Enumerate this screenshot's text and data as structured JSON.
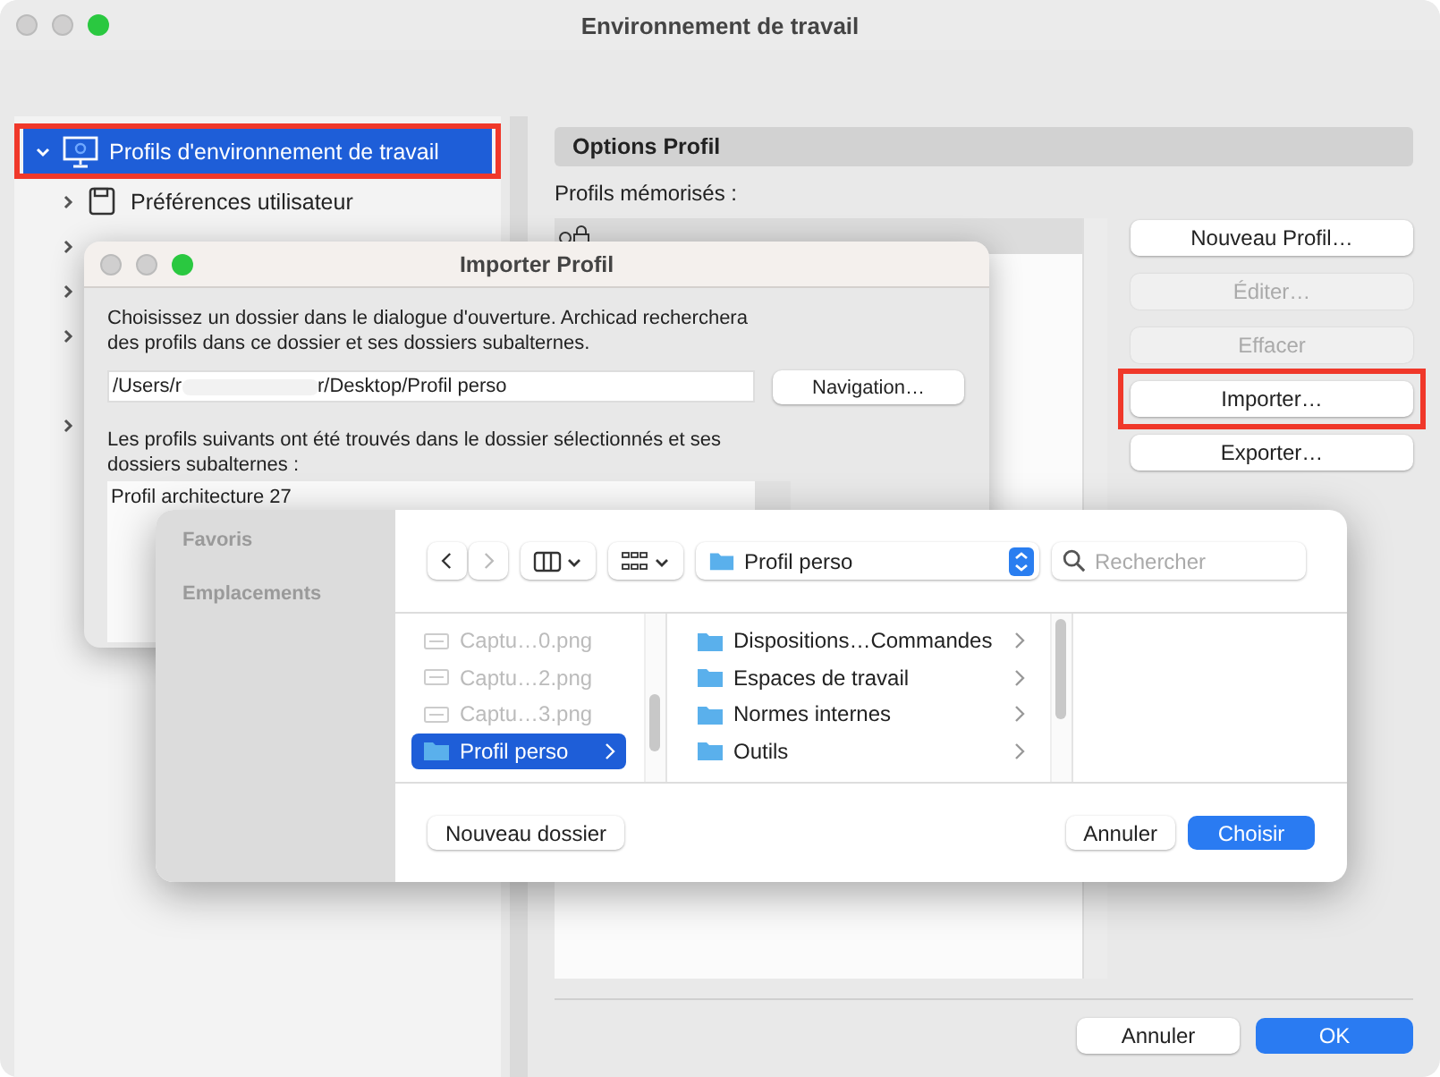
{
  "window": {
    "title": "Environnement de travail"
  },
  "tree": [
    {
      "label": "Profils d'environnement de travail",
      "selected": true,
      "expanded": true,
      "annotated": true,
      "children": [
        {
          "label": "Préférences utilisateur",
          "expandable": true
        },
        {
          "expandable": true
        },
        {
          "expandable": true
        },
        {
          "expandable": true
        },
        {
          "expandable": false
        },
        {
          "expandable": true
        }
      ]
    }
  ],
  "options": {
    "title": "Options Profil",
    "list_label": "Profils mémorisés :",
    "profiles": [
      {
        "selected": true
      }
    ],
    "buttons": [
      {
        "label": "Nouveau Profil…",
        "disabled": false,
        "annotated": false
      },
      {
        "label": "Éditer…",
        "disabled": true,
        "annotated": false
      },
      {
        "label": "Effacer",
        "disabled": true,
        "annotated": false
      },
      {
        "label": "Importer…",
        "disabled": false,
        "annotated": true
      },
      {
        "label": "Exporter…",
        "disabled": false,
        "annotated": false
      }
    ]
  },
  "footer_buttons": [
    {
      "label": "Annuler",
      "primary": false
    },
    {
      "label": "OK",
      "primary": true
    }
  ],
  "import_dialog": {
    "title": "Importer Profil",
    "instructions": "Choisissez un dossier dans le dialogue d'ouverture. Archicad recherchera des profils dans ce dossier et ses dossiers subalternes.",
    "path_start": "/Users/r",
    "path_end": "r/Desktop/Profil perso",
    "browse_button": "Navigation…",
    "found_label": "Les profils suivants ont été trouvés dans le dossier sélectionnés et ses dossiers subalternes :",
    "found": [
      "Profil architecture 27"
    ]
  },
  "finder": {
    "sidebar": [
      "Favoris",
      "Emplacements"
    ],
    "location": "Profil perso",
    "search_placeholder": "Rechercher",
    "column_1": [
      {
        "label": "Captu…0.png",
        "kind": "file",
        "disabled": true,
        "selected": false
      },
      {
        "label": "Captu…2.png",
        "kind": "file",
        "disabled": true,
        "selected": false
      },
      {
        "label": "Captu…3.png",
        "kind": "file",
        "disabled": true,
        "selected": false
      },
      {
        "label": "Profil perso",
        "kind": "folder",
        "disabled": false,
        "selected": true
      }
    ],
    "column_2": [
      {
        "label": "Dispositions…Commandes",
        "kind": "folder",
        "disabled": false,
        "selected": false
      },
      {
        "label": "Espaces de travail",
        "kind": "folder",
        "disabled": false,
        "selected": false
      },
      {
        "label": "Normes internes",
        "kind": "folder",
        "disabled": false,
        "selected": false
      },
      {
        "label": "Outils",
        "kind": "folder",
        "disabled": false,
        "selected": false
      }
    ],
    "buttons": [
      {
        "label": "Nouveau dossier",
        "primary": false
      },
      {
        "label": "Annuler",
        "primary": false
      },
      {
        "label": "Choisir",
        "primary": true
      }
    ]
  }
}
